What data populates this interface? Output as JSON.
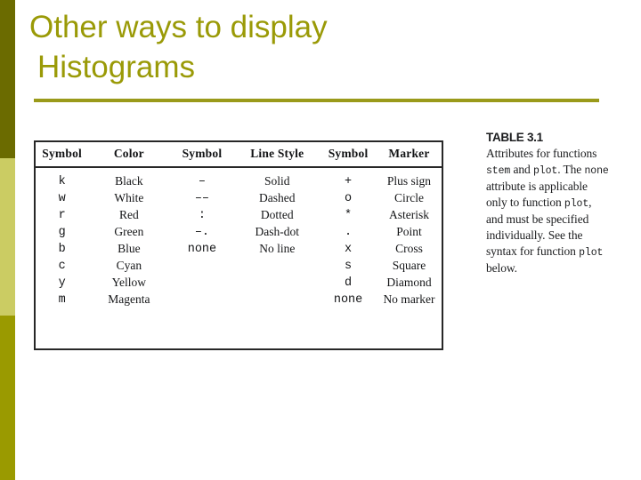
{
  "slide": {
    "title_line_1": "Other ways to display",
    "title_line_2": "Histograms",
    "title_color": "#9a9a07",
    "rule_color": "#9a9a1a",
    "background_color": "#ffffff"
  },
  "side_band": {
    "segment_top_color": "#6b6b00",
    "segment_middle_color": "#cbcc63",
    "segment_bottom_color": "#9a9a00"
  },
  "table": {
    "headers": [
      "Symbol",
      "Color",
      "Symbol",
      "Line Style",
      "Symbol",
      "Marker"
    ],
    "rows": [
      [
        "k",
        "Black",
        "–",
        "Solid",
        "+",
        "Plus sign"
      ],
      [
        "w",
        "White",
        "––",
        "Dashed",
        "o",
        "Circle"
      ],
      [
        "r",
        "Red",
        ":",
        "Dotted",
        "*",
        "Asterisk"
      ],
      [
        "g",
        "Green",
        "–.",
        "Dash-dot",
        ".",
        "Point"
      ],
      [
        "b",
        "Blue",
        "none",
        "No line",
        "x",
        "Cross"
      ],
      [
        "c",
        "Cyan",
        "",
        "",
        "s",
        "Square"
      ],
      [
        "y",
        "Yellow",
        "",
        "",
        "d",
        "Diamond"
      ],
      [
        "m",
        "Magenta",
        "",
        "",
        "none",
        "No marker"
      ]
    ]
  },
  "caption": {
    "heading": "TABLE 3.1",
    "body_part_1": "Attributes for functions ",
    "code_1": "stem",
    "body_part_2": " and ",
    "code_2": "plot",
    "body_part_3": ". The ",
    "code_3": "none",
    "body_part_4": " attribute is applicable only to function ",
    "code_4": "plot",
    "body_part_5": ", and must be specified individually. See the syntax for function ",
    "code_5": "plot",
    "body_part_6": " below."
  }
}
